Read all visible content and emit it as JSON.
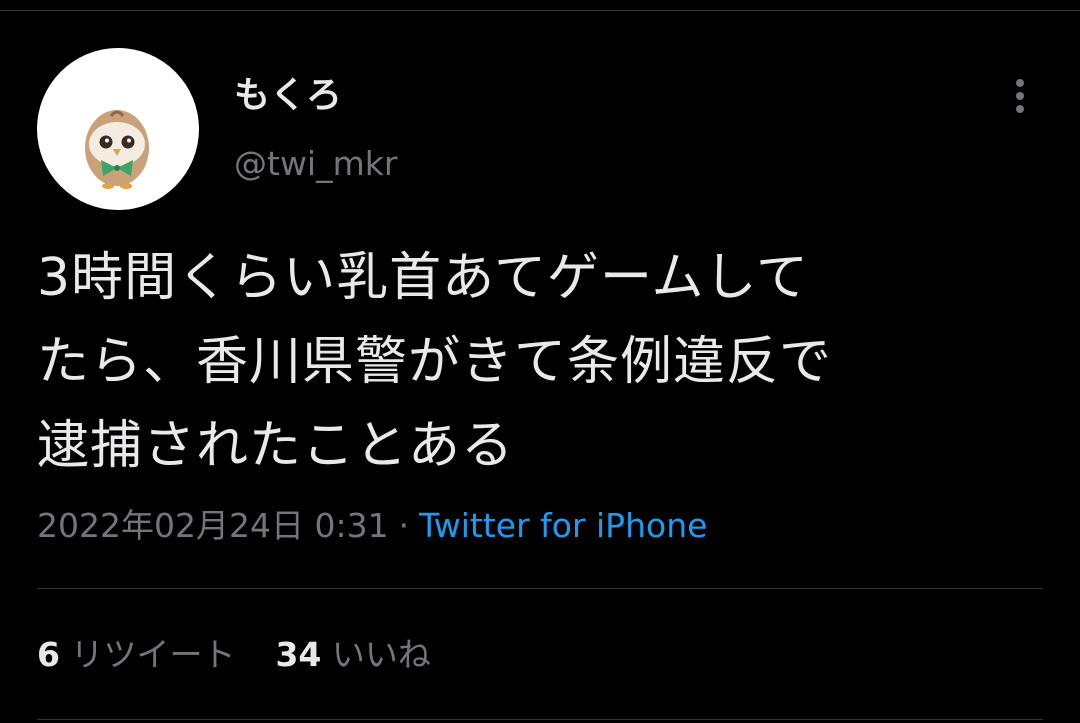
{
  "tweet": {
    "author": {
      "display_name": "もくろ",
      "handle": "@twi_mkr",
      "avatar_icon": "owl-avatar-icon"
    },
    "text": "3時間くらい乳首あてゲームして\nたら、香川県警がきて条例違反で\n逮捕されたことある",
    "timestamp": "2022年02月24日 0:31",
    "separator": "·",
    "source": "Twitter for iPhone",
    "stats": {
      "retweets_count": "6",
      "retweets_label": "リツイート",
      "likes_count": "34",
      "likes_label": "いいね"
    },
    "more_icon": "more-vertical-icon"
  },
  "colors": {
    "background": "#000000",
    "primary_text": "#e7e9ea",
    "secondary_text": "#71767b",
    "link": "#1d9bf0",
    "divider": "#2f3336"
  }
}
